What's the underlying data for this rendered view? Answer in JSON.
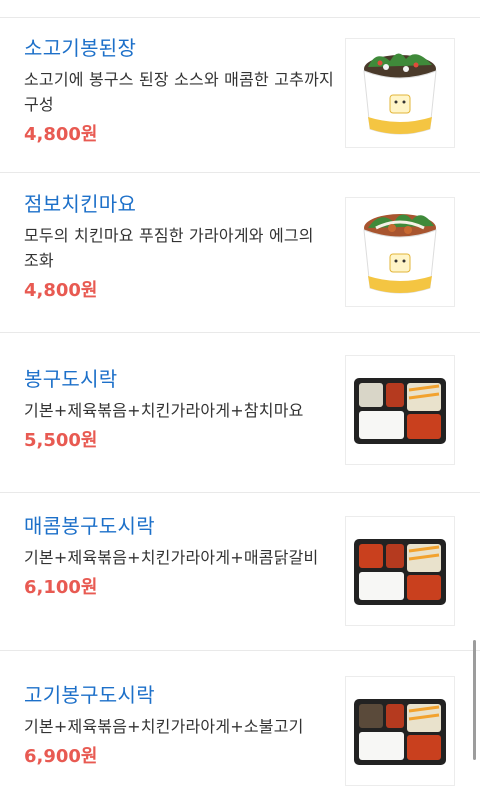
{
  "menu_items": [
    {
      "name": "소고기봉된장",
      "description": "소고기에 봉구스 된장 소스와 매콤한 고추까지 구성",
      "price": "4,800원",
      "image": "rice-bowl-icon"
    },
    {
      "name": "점보치킨마요",
      "description": "모두의 치킨마요 푸짐한 가라아게와 에그의 조화",
      "price": "4,800원",
      "image": "rice-bowl-icon"
    },
    {
      "name": "봉구도시락",
      "description": "기본+제육볶음+치킨가라아게+참치마요",
      "price": "5,500원",
      "image": "lunchbox-icon"
    },
    {
      "name": "매콤봉구도시락",
      "description": "기본+제육볶음+치킨가라아게+매콤닭갈비",
      "price": "6,100원",
      "image": "lunchbox-icon"
    },
    {
      "name": "고기봉구도시락",
      "description": "기본+제육볶음+치킨가라아게+소불고기",
      "price": "6,900원",
      "image": "lunchbox-icon"
    }
  ],
  "colors": {
    "name": "#1d70c9",
    "price": "#e85a52",
    "divider": "#e9e9e9",
    "bowl_band": "#f4c542"
  }
}
